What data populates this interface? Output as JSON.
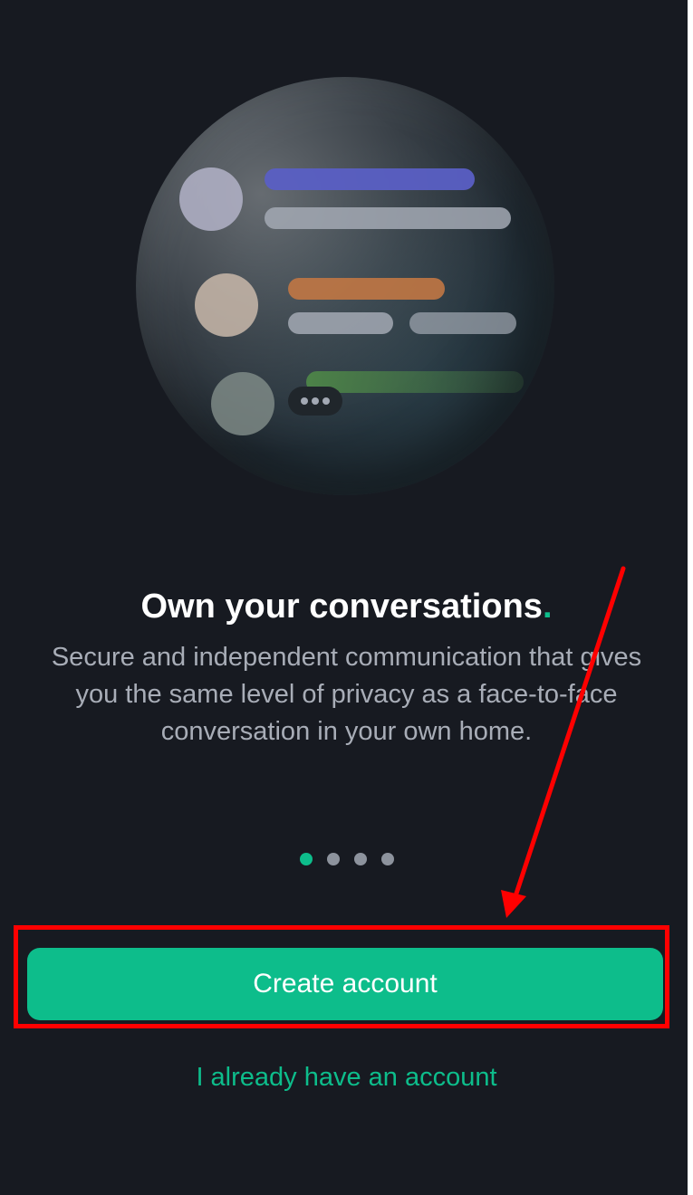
{
  "onboarding": {
    "title": "Own your conversations",
    "title_dot": ".",
    "description": "Secure and independent communication that gives you the same level of privacy as a face-to-face conversation in your own home.",
    "page_indicator": {
      "current": 1,
      "total": 4
    }
  },
  "actions": {
    "create_account_label": "Create account",
    "login_label": "I already have an account"
  },
  "colors": {
    "background": "#171a21",
    "accent": "#0dbd8b",
    "annotation": "#ff0000"
  },
  "illustration": {
    "typing_indicator": "typing-dots-icon"
  }
}
